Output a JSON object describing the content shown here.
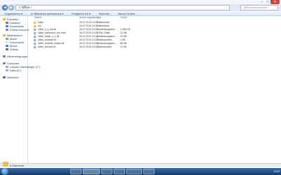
{
  "window": {
    "address": "« Office ›",
    "search_placeholder": "Office durchsuchen",
    "controls": [
      "–",
      "□",
      "✕"
    ]
  },
  "toolbar": {
    "items": [
      "Organisieren ▾",
      "In Bibliothek aufnehmen ▾",
      "Freigeben für ▾",
      "Brennen",
      "Neuer Ordner"
    ]
  },
  "nav": {
    "items": [
      {
        "label": "Favoriten",
        "kind": "header"
      },
      {
        "label": "Desktop",
        "kind": "sub"
      },
      {
        "label": "Downloads",
        "kind": "sub"
      },
      {
        "label": "Zuletzt besucht",
        "kind": "sub"
      },
      {
        "label": "Bibliotheken",
        "kind": "header"
      },
      {
        "label": "Bilder",
        "kind": "sub"
      },
      {
        "label": "Dokumente",
        "kind": "sub"
      },
      {
        "label": "Musik",
        "kind": "sub"
      },
      {
        "label": "Videos",
        "kind": "sub"
      },
      {
        "label": "Heimnetzgruppe",
        "kind": "header"
      },
      {
        "label": "Computer",
        "kind": "header"
      },
      {
        "label": "Lokaler Datenträger (C:)",
        "kind": "sub"
      },
      {
        "label": "Data (D:)",
        "kind": "sub"
      },
      {
        "label": "Netzwerk",
        "kind": "header"
      }
    ]
  },
  "columns": {
    "name": "Name",
    "date": "Änderungsdatum",
    "type": "Typ",
    "size": "Größe"
  },
  "files": [
    {
      "name": "Data",
      "date": "26.07.2010 13:02",
      "type": "Dateiordner",
      "size": "",
      "kind": "folder"
    },
    {
      "name": "src",
      "date": "26.07.2010 13:02",
      "type": "Dateiordner",
      "size": "",
      "kind": "folder"
    },
    {
      "name": "office_x_y_full.dll",
      "date": "26.07.2010 13:02",
      "type": "Anwendungserw...",
      "size": "1.406 KB",
      "kind": "file"
    },
    {
      "name": "office_command_line.html",
      "date": "26.07.2010 13:02",
      "type": "HTML-Datei",
      "size": "12 KB",
      "kind": "file"
    },
    {
      "name": "office_addin_1_1.dll",
      "date": "26.07.2010 13:02",
      "type": "Anwendungserw...",
      "size": "24 KB",
      "kind": "file"
    },
    {
      "name": "office_readme.txt",
      "date": "26.07.2010 13:02",
      "type": "Textdokument",
      "size": "2 KB",
      "kind": "file"
    },
    {
      "name": "office_readme_reader.dll",
      "date": "26.07.2010 13:02",
      "type": "Anwendungserw...",
      "size": "68 KB",
      "kind": "file"
    },
    {
      "name": "office_license.txt",
      "date": "26.07.2010 13:02",
      "type": "Textdokument",
      "size": "12 KB",
      "kind": "file"
    }
  ],
  "details": {
    "text": "8 Elemente"
  },
  "taskbar": {
    "buttons": [
      "",
      "",
      "",
      "",
      "",
      ""
    ],
    "clock": "13:03"
  }
}
